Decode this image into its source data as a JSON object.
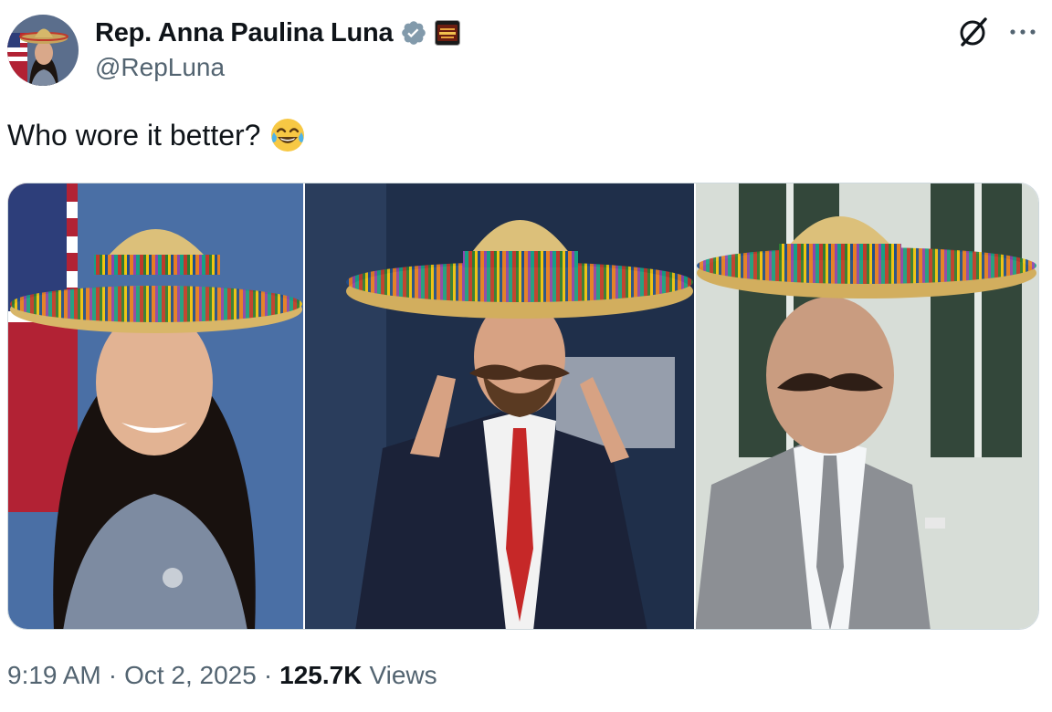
{
  "author": {
    "display_name": "Rep. Anna Paulina Luna",
    "handle": "@RepLuna"
  },
  "tweet": {
    "text": "Who wore it better?",
    "emoji": "face-with-tears-of-joy"
  },
  "footer": {
    "time": "9:19 AM",
    "separator": "·",
    "date": "Oct 2, 2025",
    "views_count": "125.7K",
    "views_label": "Views"
  },
  "icons": {
    "verified": "verified-badge",
    "affiliate": "affiliate-badge",
    "grok": "grok-icon",
    "more": "more-icon"
  },
  "colors": {
    "text_primary": "#0f1419",
    "text_secondary": "#536471",
    "verified_gray": "#829aab",
    "border": "#cfd9de"
  }
}
